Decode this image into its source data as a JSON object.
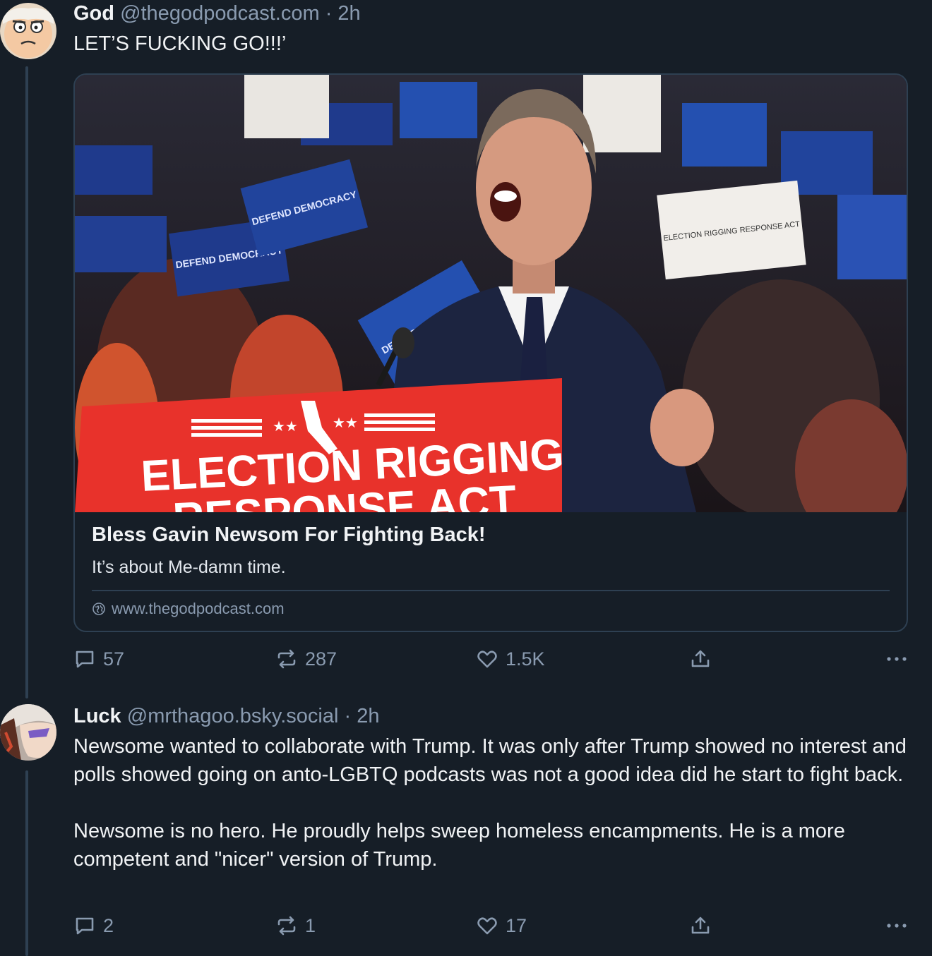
{
  "post1": {
    "author_name": "God",
    "author_handle": "@thegodpodcast.com",
    "separator": "·",
    "timestamp": "2h",
    "text": "LET’S FUCKING GO!!!’",
    "embed": {
      "image_sign_top": "ELECTION RIGGING",
      "image_sign_bottom": "RESPONSE ACT",
      "image_placards": [
        "DEFEND DEMOCRACY",
        "ELECTION RIGGING RESPONSE ACT"
      ],
      "title": "Bless Gavin Newsom For Fighting Back!",
      "description": "It’s about Me-damn time.",
      "domain": "www.thegodpodcast.com"
    },
    "actions": {
      "replies": "57",
      "reposts": "287",
      "likes": "1.5K"
    }
  },
  "post2": {
    "author_name": "Luck",
    "author_handle": "@mrthagoo.bsky.social",
    "separator": "·",
    "timestamp": "2h",
    "text": "Newsome wanted to collaborate with Trump. It was only after Trump showed no interest and polls showed going on anto-LGBTQ podcasts was not a good idea did he start to fight back.\n\nNewsome is no hero. He proudly helps sweep homeless encampments. He is a more competent and \"nicer\" version of Trump.",
    "actions": {
      "replies": "2",
      "reposts": "1",
      "likes": "17"
    }
  },
  "icons": [
    "reply-icon",
    "repost-icon",
    "like-icon",
    "share-icon",
    "more-icon",
    "globe-icon"
  ],
  "colors": {
    "background": "#161e27",
    "muted": "#8a9bb0",
    "border": "#2e4052",
    "sign_red": "#e8322b"
  }
}
